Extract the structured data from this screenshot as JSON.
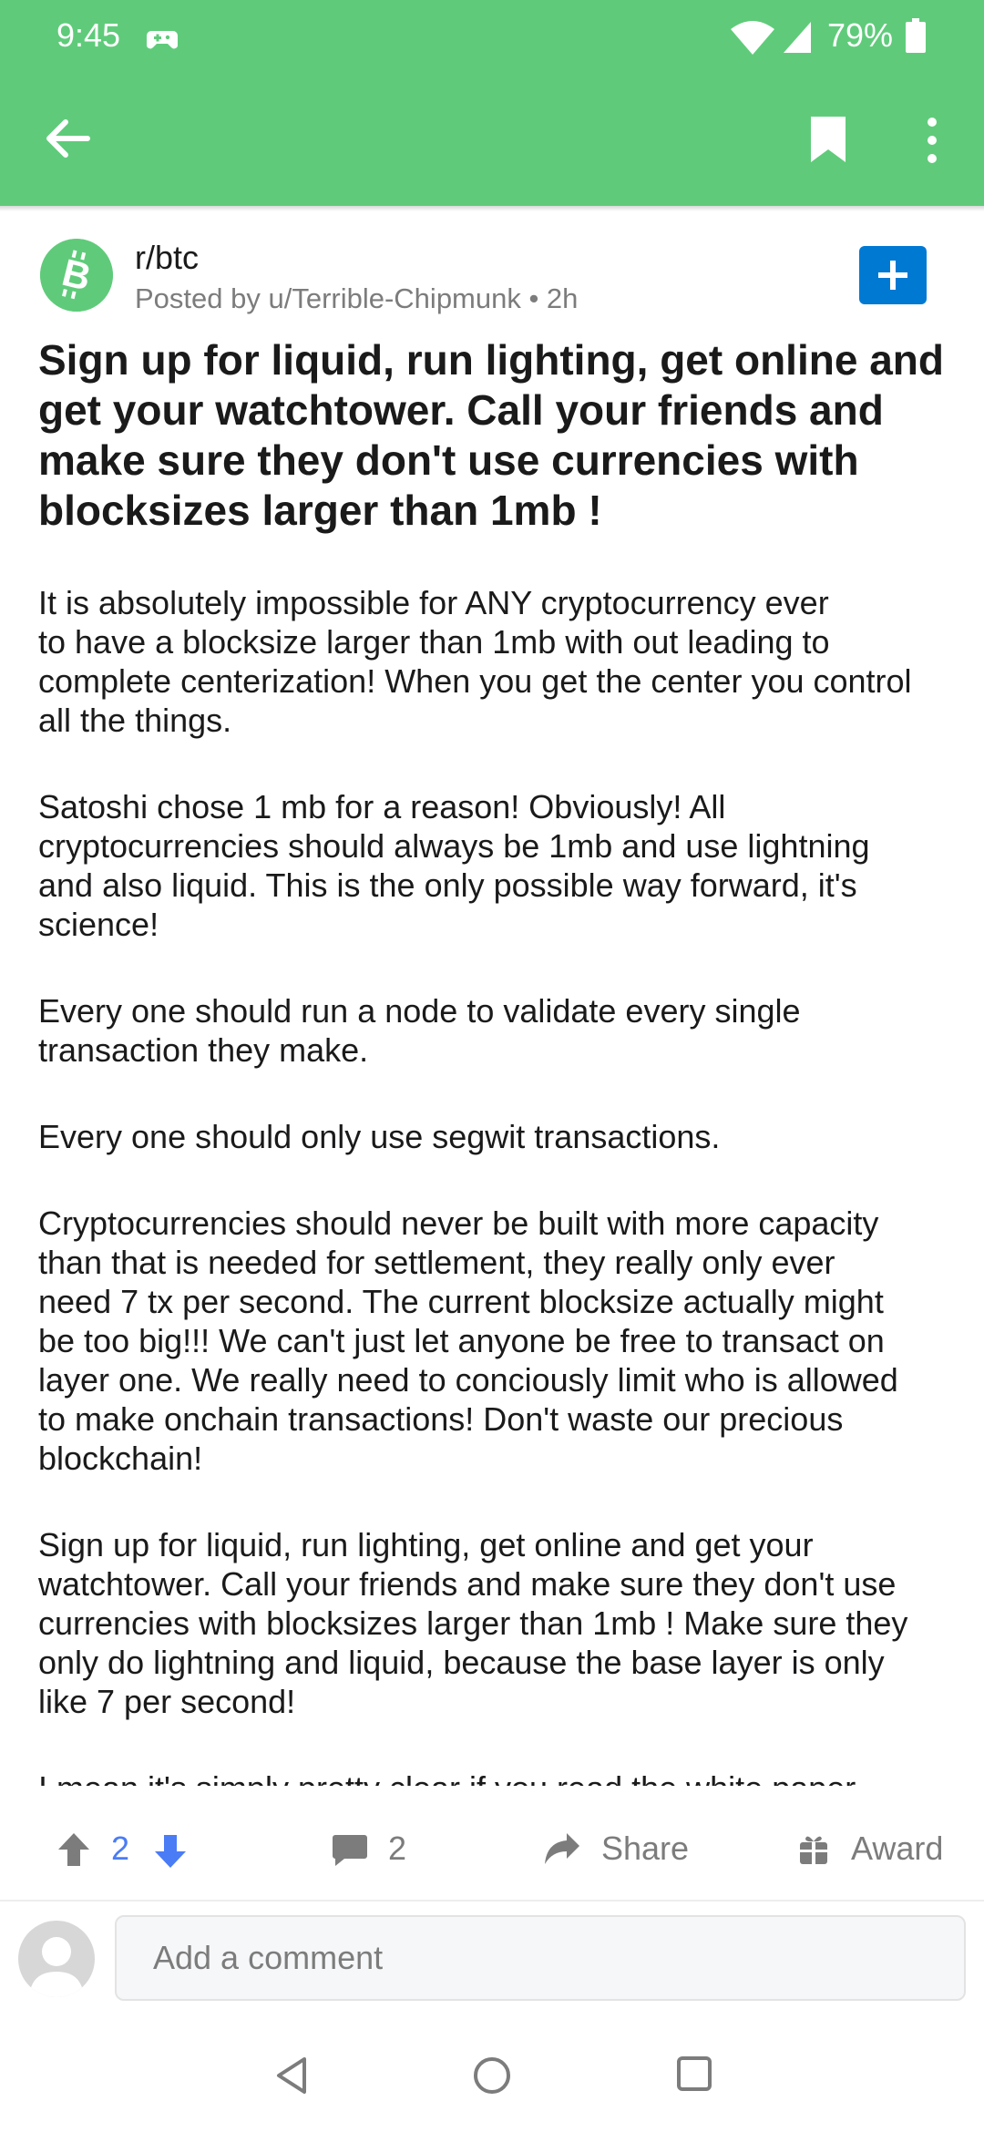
{
  "status_bar": {
    "time": "9:45",
    "battery": "79%"
  },
  "toolbar": {
    "icons": [
      "back-arrow-icon",
      "bookmark-icon",
      "more-vertical-icon"
    ]
  },
  "post": {
    "subreddit": "r/btc",
    "meta": "Posted by u/Terrible-Chipmunk • 2h",
    "title": "Sign up for liquid, run lighting, get online and\nget your watchtower. Call your friends and\nmake sure they don't use currencies with\nblocksizes larger than 1mb !",
    "paragraphs": [
      "It is absolutely impossible for ANY cryptocurrency ever\nto have a blocksize larger than 1mb with out leading to\ncomplete centerization! When you get the center you control\nall the things.",
      "Satoshi chose 1 mb for a reason! Obviously! All\ncryptocurrencies should always be 1mb and use lightning\nand also liquid. This is the only possible way forward, it's\nscience!",
      "Every one should run a node to validate every single\ntransaction they make.",
      "Every one should only use segwit transactions.",
      "Cryptocurrencies should never be built with more capacity\nthan that is needed for settlement, they really only ever\nneed 7 tx per second. The current blocksize actually might\nbe too big!!! We can't just let anyone be free to transact on\nlayer one. We really need to conciously limit who is allowed\nto make onchain transactions! Don't waste our precious\nblockchain!",
      "Sign up for liquid, run lighting, get online and get your\nwatchtower. Call your friends and make sure they don't use\ncurrencies with blocksizes larger than 1mb ! Make sure they\nonly do lightning and liquid, because the base layer is only\nlike 7 per second!",
      "I mean it's simply pretty clear if you read the white paper"
    ]
  },
  "actions": {
    "score": "2",
    "comments": "2",
    "share": "Share",
    "award": "Award"
  },
  "comment_box": {
    "placeholder": "Add a comment"
  },
  "colors": {
    "header": "#5fcb7a",
    "join_button": "#0079d3",
    "upvote_active": "#4a7cf6"
  }
}
